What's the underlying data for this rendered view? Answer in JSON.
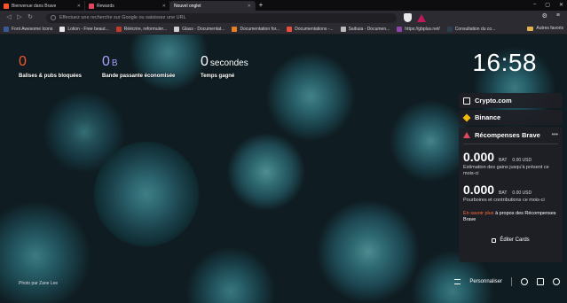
{
  "tabs": [
    {
      "label": "Bienvenue dans Brave",
      "favicon_color": "#fb542b",
      "active": false
    },
    {
      "label": "Rewards",
      "favicon_color": "#e0465d",
      "active": false
    },
    {
      "label": "Nouvel onglet",
      "favicon_color": "",
      "active": true
    }
  ],
  "new_tab_glyph": "+",
  "window_buttons": {
    "minimize": "–",
    "maximize": "▢",
    "close": "✕"
  },
  "toolbar": {
    "back": "◁",
    "forward": "▷",
    "reload": "↻",
    "omnibox_placeholder": "Effectuez une recherche sur Google ou saisissez une URL",
    "extensions_glyph": "⚙",
    "menu_glyph": "≡"
  },
  "bookmarks": [
    {
      "label": "Font Awesome Icons",
      "color": "#3b5998"
    },
    {
      "label": "Lotion - Free beaut...",
      "color": "#e8e8e8"
    },
    {
      "label": "Réécrire, reformuler...",
      "color": "#c0392b"
    },
    {
      "label": "Glass - Documentat...",
      "color": "#d0d0d0"
    },
    {
      "label": "Documentation for...",
      "color": "#e67e22"
    },
    {
      "label": "Documentations -...",
      "color": "#e74c3c"
    },
    {
      "label": "Saibuia - Documen...",
      "color": "#bbbbbb"
    },
    {
      "label": "https://gbplus.net/",
      "color": "#8e44ad"
    },
    {
      "label": "Consultation du co...",
      "color": "#2c3e50"
    }
  ],
  "bookmarks_folder": "Autres favoris",
  "stats": [
    {
      "value": "0",
      "unit": "",
      "label": "Balises & pubs bloquées",
      "color": "#fb542b"
    },
    {
      "value": "0",
      "unit": "B",
      "label": "Bande passante économisée",
      "color": "#a8a0ff"
    },
    {
      "value": "0",
      "unit": "secondes",
      "label": "Temps gagné",
      "color": "#ffffff"
    }
  ],
  "clock": "16:58",
  "cards": {
    "crypto": {
      "label": "Crypto.com"
    },
    "binance": {
      "label": "Binance"
    },
    "rewards": {
      "title": "Récompenses Brave",
      "more": "•••",
      "estimate": {
        "amount": "0.000",
        "currency": "BAT",
        "usd": "0.00 USD",
        "description": "Estimation des gains jusqu'à présent ce mois-ci"
      },
      "tips": {
        "amount": "0.000",
        "currency": "BAT",
        "usd": "0.00 USD",
        "description": "Pourboires et contributions ce mois-ci"
      },
      "learn_link": "En savoir plus",
      "learn_text": "à propos des Récompenses Brave"
    }
  },
  "edit_cards": "Éditer Cards",
  "photo_credit": "Photo par Zane Lee",
  "customize": "Personnaliser",
  "accent_color": "#fb542b"
}
